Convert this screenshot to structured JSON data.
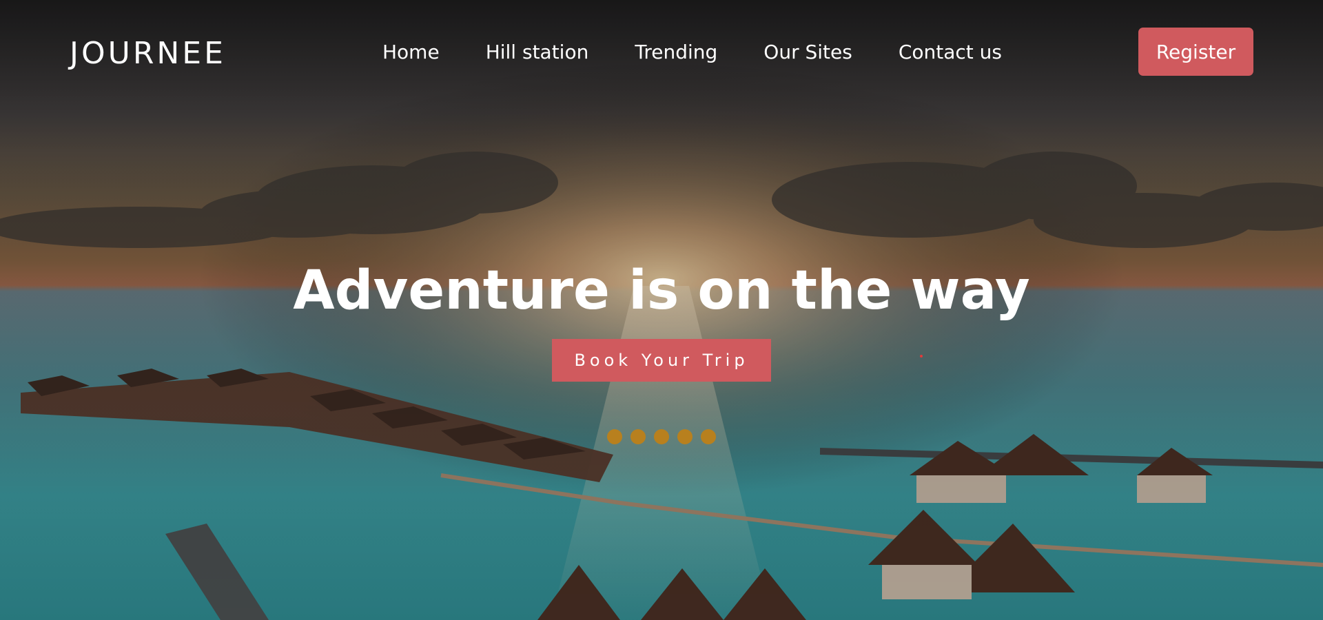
{
  "brand": {
    "logo_text": "JOURNEE"
  },
  "nav": {
    "items": [
      {
        "label": "Home"
      },
      {
        "label": "Hill station"
      },
      {
        "label": "Trending"
      },
      {
        "label": "Our Sites"
      },
      {
        "label": "Contact us"
      }
    ],
    "register_label": "Register"
  },
  "hero": {
    "headline": "Adventure is on the way",
    "cta_label": "Book Your Trip",
    "slider_dot_count": 5,
    "background": "sunset-over-ocean-water-villas-photo"
  },
  "colors": {
    "accent": "#d05a5e",
    "dot": "#b8801e",
    "text": "#ffffff"
  }
}
